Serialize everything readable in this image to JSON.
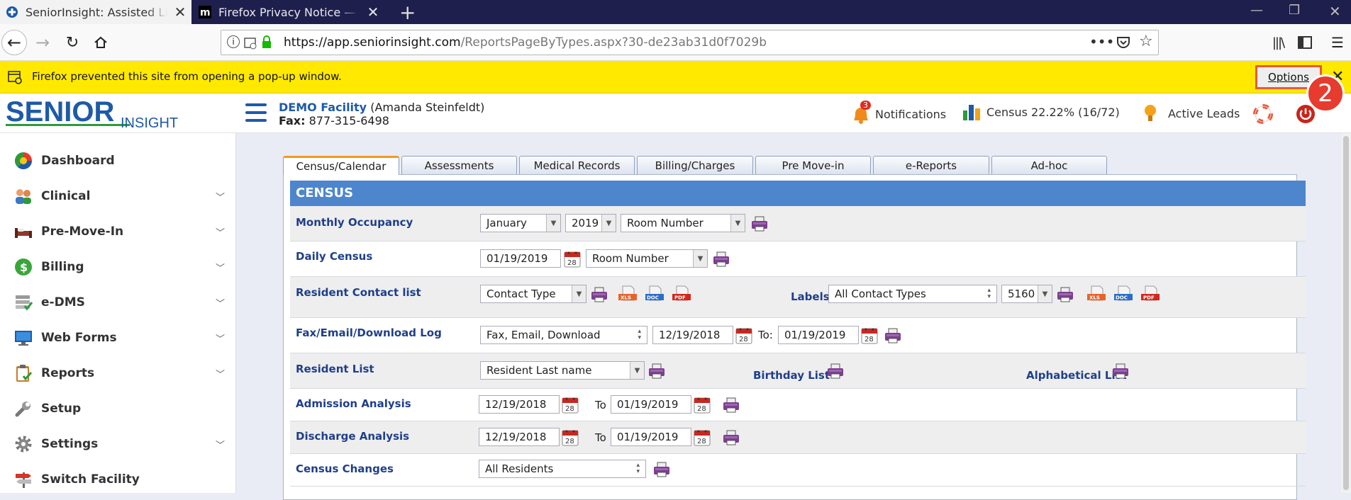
{
  "browser": {
    "tabs": [
      {
        "title": "SeniorInsight: Assisted Living Management"
      },
      {
        "title": "Firefox Privacy Notice — Mozilla"
      }
    ],
    "url_host": "https://app.seniorinsight.com",
    "url_path": "/ReportsPageByTypes.aspx?30-de23ab31d0f7029b",
    "popup_message": "Firefox prevented this site from opening a pop-up window.",
    "options_label": "Options",
    "step_marker": "2"
  },
  "header": {
    "logo_main": "SENIOR",
    "logo_sub": "INSIGHT",
    "facility_name": "DEMO Facility",
    "facility_user": "(Amanda Steinfeldt)",
    "fax_label": "Fax:",
    "fax_number": "877-315-6498",
    "notifications_count": "3",
    "notifications_label": "Notifications",
    "census_label": "Census 22.22% (16/72)",
    "leads_label": "Active Leads"
  },
  "sidebar": {
    "items": [
      {
        "label": "Dashboard"
      },
      {
        "label": "Clinical"
      },
      {
        "label": "Pre-Move-In"
      },
      {
        "label": "Billing"
      },
      {
        "label": "e-DMS"
      },
      {
        "label": "Web Forms"
      },
      {
        "label": "Reports"
      },
      {
        "label": "Setup"
      },
      {
        "label": "Settings"
      },
      {
        "label": "Switch Facility"
      }
    ]
  },
  "report_tabs": [
    "Census/Calendar",
    "Assessments",
    "Medical Records",
    "Billing/Charges",
    "Pre Move-in",
    "e-Reports",
    "Ad-hoc"
  ],
  "census": {
    "title": "CENSUS",
    "monthly_occupancy": {
      "label": "Monthly Occupancy",
      "month": "January",
      "year": "2019",
      "sort": "Room Number"
    },
    "daily_census": {
      "label": "Daily Census",
      "date": "01/19/2019",
      "sort": "Room Number"
    },
    "resident_contact": {
      "label": "Resident Contact list",
      "type": "Contact Type",
      "labels_label": "Labels",
      "labels_type": "All Contact Types",
      "labels_size": "5160"
    },
    "fax_log": {
      "label": "Fax/Email/Download Log",
      "type": "Fax, Email, Download",
      "from": "12/19/2018",
      "to_label": "To:",
      "to": "01/19/2019"
    },
    "resident_list": {
      "label": "Resident List",
      "sort": "Resident Last name",
      "birthday_label": "Birthday List",
      "alpha_label": "Alphabetical List"
    },
    "admission": {
      "label": "Admission Analysis",
      "from": "12/19/2018",
      "to_label": "To",
      "to": "01/19/2019"
    },
    "discharge": {
      "label": "Discharge Analysis",
      "from": "12/19/2018",
      "to_label": "To",
      "to": "01/19/2019"
    },
    "changes": {
      "label": "Census Changes",
      "filter": "All Residents"
    },
    "calendar_day": "28",
    "file_labels": {
      "xls": "XLS",
      "doc": "DOC",
      "pdf": "PDF"
    }
  }
}
